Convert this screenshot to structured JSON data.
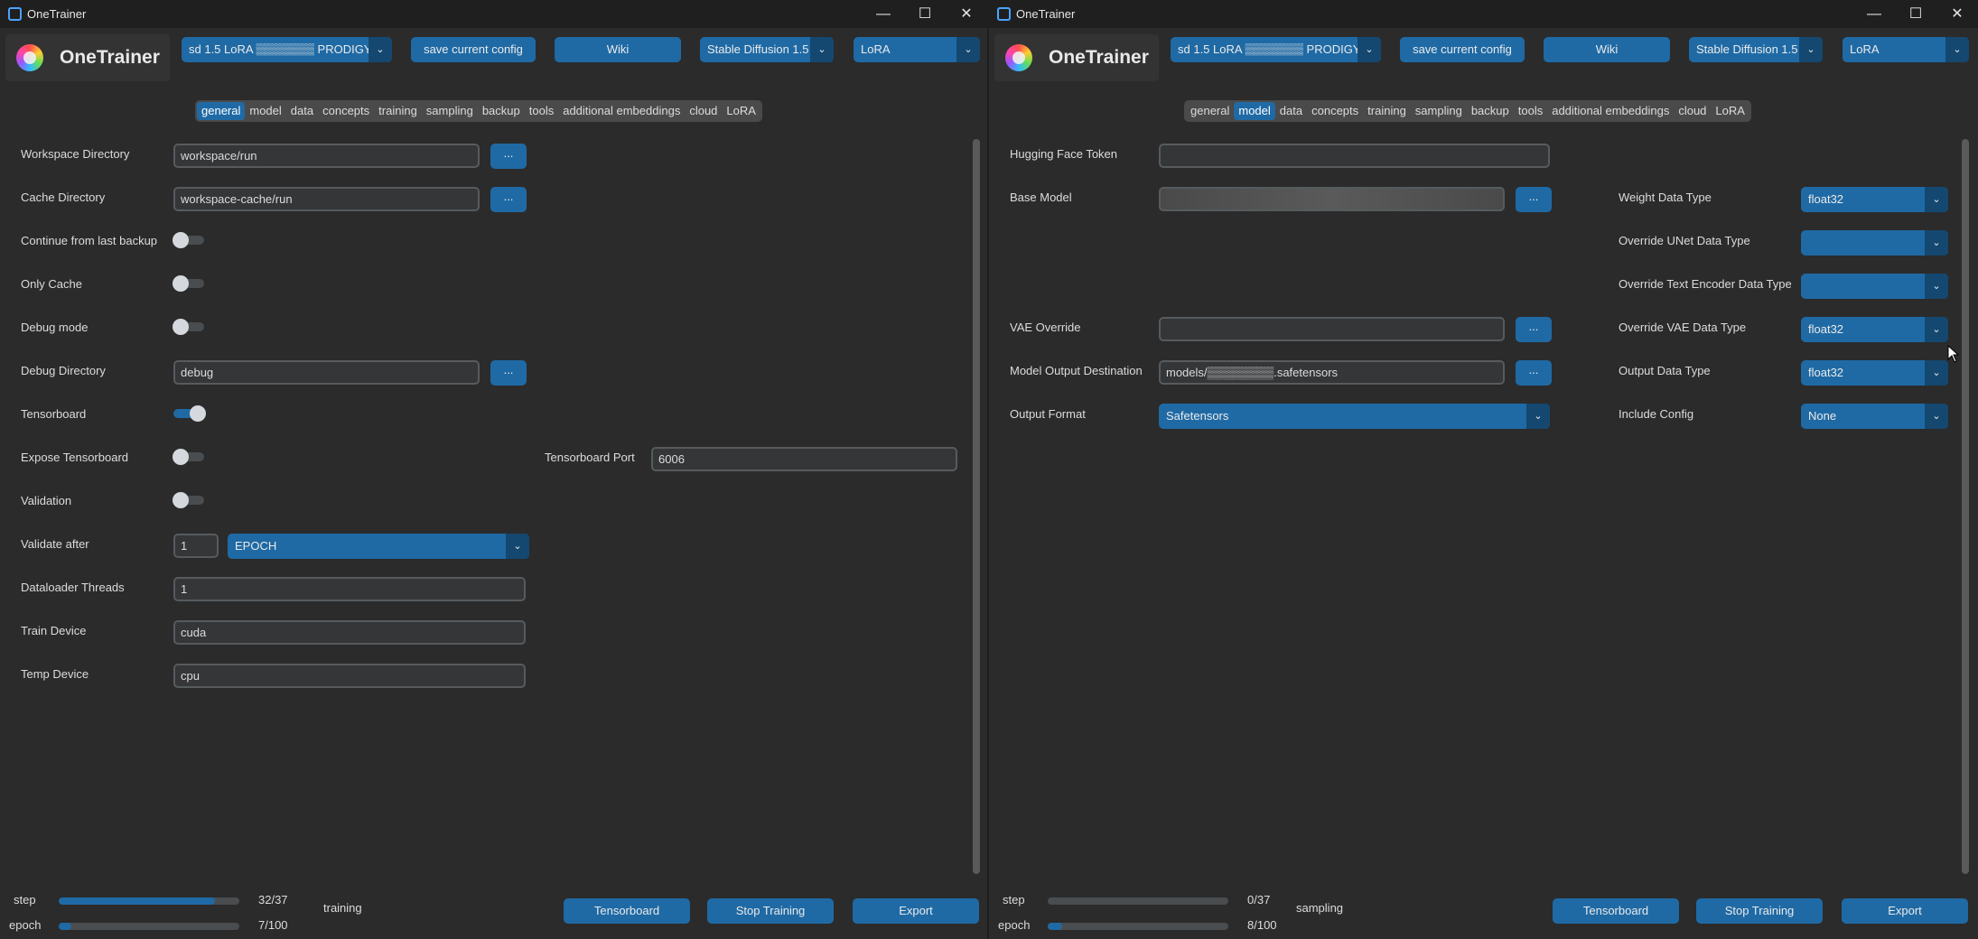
{
  "left": {
    "title": "OneTrainer",
    "logo": "OneTrainer",
    "config": "sd 1.5 LoRA ▒▒▒▒▒▒▒ PRODIGY",
    "save_config": "save current config",
    "wiki": "Wiki",
    "model_type": "Stable Diffusion 1.5",
    "training_method": "LoRA",
    "tabs": [
      "general",
      "model",
      "data",
      "concepts",
      "training",
      "sampling",
      "backup",
      "tools",
      "additional embeddings",
      "cloud",
      "LoRA"
    ],
    "active_tab": "general",
    "fields": {
      "workspace_label": "Workspace Directory",
      "workspace_value": "workspace/run",
      "cache_label": "Cache Directory",
      "cache_value": "workspace-cache/run",
      "continue_label": "Continue from last backup",
      "only_cache_label": "Only Cache",
      "debug_mode_label": "Debug mode",
      "debug_dir_label": "Debug Directory",
      "debug_dir_value": "debug",
      "tensorboard_label": "Tensorboard",
      "expose_tb_label": "Expose Tensorboard",
      "tb_port_label": "Tensorboard Port",
      "tb_port_value": "6006",
      "validation_label": "Validation",
      "validate_after_label": "Validate after",
      "validate_after_value": "1",
      "validate_after_unit": "EPOCH",
      "dataloader_label": "Dataloader Threads",
      "dataloader_value": "1",
      "train_device_label": "Train Device",
      "train_device_value": "cuda",
      "temp_device_label": "Temp Device",
      "temp_device_value": "cpu",
      "dots": "..."
    },
    "toggles": {
      "continue": false,
      "only_cache": false,
      "debug_mode": false,
      "tensorboard": true,
      "expose_tb": false,
      "validation": false
    },
    "progress": {
      "step_label": "step",
      "step_count": "32/37",
      "step_fraction": 0.865,
      "epoch_label": "epoch",
      "epoch_count": "7/100",
      "epoch_fraction": 0.07,
      "status": "training"
    },
    "buttons": {
      "tensorboard": "Tensorboard",
      "stop": "Stop Training",
      "export": "Export"
    }
  },
  "right": {
    "title": "OneTrainer",
    "logo": "OneTrainer",
    "config": "sd 1.5 LoRA ▒▒▒▒▒▒▒ PRODIGY",
    "save_config": "save current config",
    "wiki": "Wiki",
    "model_type": "Stable Diffusion 1.5",
    "training_method": "LoRA",
    "tabs": [
      "general",
      "model",
      "data",
      "concepts",
      "training",
      "sampling",
      "backup",
      "tools",
      "additional embeddings",
      "cloud",
      "LoRA"
    ],
    "active_tab": "model",
    "fields": {
      "hf_token_label": "Hugging Face Token",
      "hf_token_value": "",
      "base_model_label": "Base Model",
      "base_model_value": "",
      "vae_label": "VAE Override",
      "vae_value": "",
      "output_dest_label": "Model Output Destination",
      "output_dest_value": "models/▒▒▒▒▒▒▒▒.safetensors",
      "output_format_label": "Output Format",
      "output_format_value": "Safetensors",
      "weight_dtype_label": "Weight Data Type",
      "weight_dtype_value": "float32",
      "unet_dtype_label": "Override UNet Data Type",
      "unet_dtype_value": "",
      "te_dtype_label": "Override Text Encoder Data Type",
      "te_dtype_value": "",
      "vae_dtype_label": "Override VAE Data Type",
      "vae_dtype_value": "float32",
      "output_dtype_label": "Output Data Type",
      "output_dtype_value": "float32",
      "include_config_label": "Include Config",
      "include_config_value": "None",
      "dots": "..."
    },
    "progress": {
      "step_label": "step",
      "step_count": "0/37",
      "step_fraction": 0.0,
      "epoch_label": "epoch",
      "epoch_count": "8/100",
      "epoch_fraction": 0.08,
      "status": "sampling"
    },
    "buttons": {
      "tensorboard": "Tensorboard",
      "stop": "Stop Training",
      "export": "Export"
    }
  },
  "icons": {
    "minimize": "minimize-icon",
    "maximize": "maximize-icon",
    "close": "close-icon",
    "chevron": "chevron-down-icon"
  },
  "colors": {
    "accent": "#1f6aa5",
    "accent_dark": "#144870",
    "background": "#2b2b2b",
    "entry_bg": "#343638"
  }
}
